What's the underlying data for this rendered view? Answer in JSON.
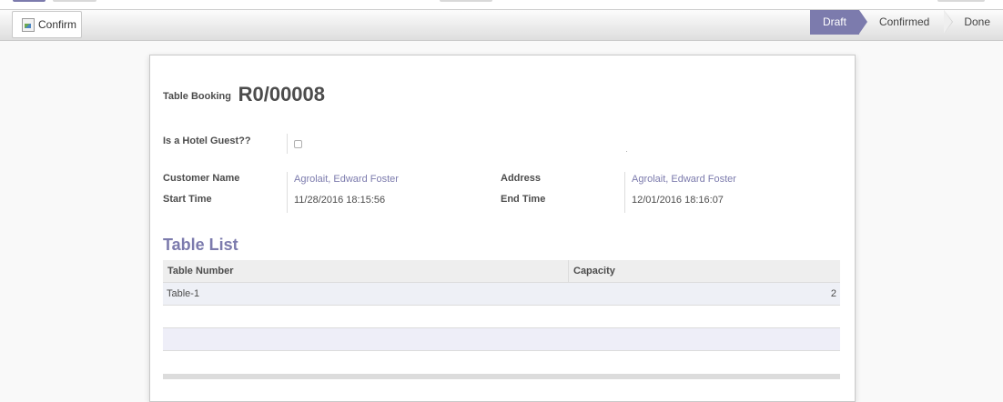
{
  "statusbar": {
    "confirm_label": "Confirm",
    "stages": [
      "Draft",
      "Confirmed",
      "Done"
    ],
    "active_stage": "Draft"
  },
  "form": {
    "title_label": "Table Booking",
    "reference": "R0/00008",
    "hotel_guest_label": "Is a Hotel Guest??",
    "hotel_guest_checked": false,
    "customer_name_label": "Customer Name",
    "customer_name": "Agrolait, Edward Foster",
    "address_label": "Address",
    "address": "Agrolait, Edward Foster",
    "start_time_label": "Start Time",
    "start_time": "11/28/2016 18:15:56",
    "end_time_label": "End Time",
    "end_time": "12/01/2016 18:16:07"
  },
  "table_list": {
    "heading": "Table List",
    "columns": [
      "Table Number",
      "Capacity"
    ],
    "rows": [
      {
        "table_number": "Table-1",
        "capacity": "2"
      }
    ]
  },
  "colors": {
    "accent": "#7c7bad",
    "sheet_bg": "#ffffff",
    "page_bg": "#f9f9f9"
  }
}
